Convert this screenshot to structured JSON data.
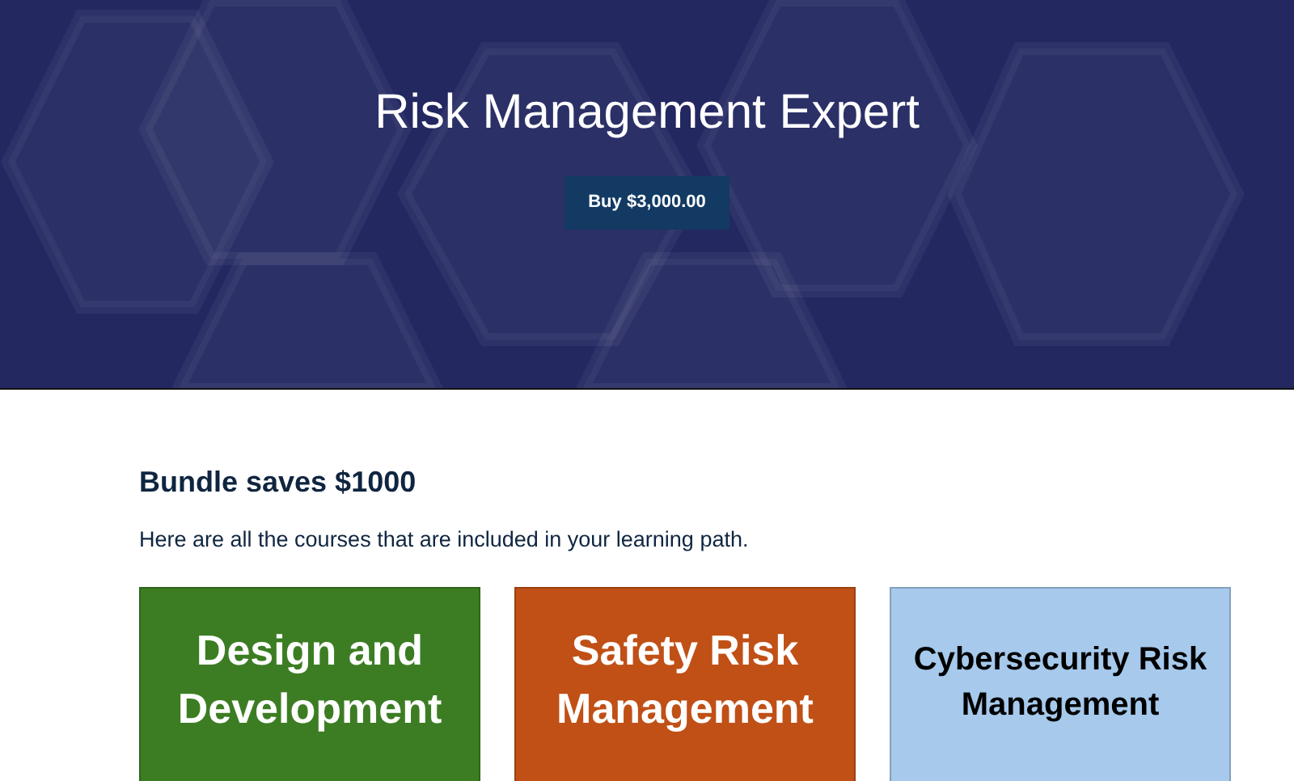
{
  "hero": {
    "title": "Risk Management Expert",
    "buy_button": "Buy $3,000.00"
  },
  "bundle": {
    "heading": "Bundle saves $1000",
    "description": "Here are all the courses that are included in your learning path."
  },
  "courses": [
    {
      "title": "Design and Development",
      "color": "#3c7d23",
      "kind": "light"
    },
    {
      "title": "Safety Risk Management",
      "color": "#c05016",
      "kind": "light"
    },
    {
      "title": "Cybersecurity Risk Management",
      "color": "#a6c9ec",
      "kind": "dark"
    }
  ]
}
